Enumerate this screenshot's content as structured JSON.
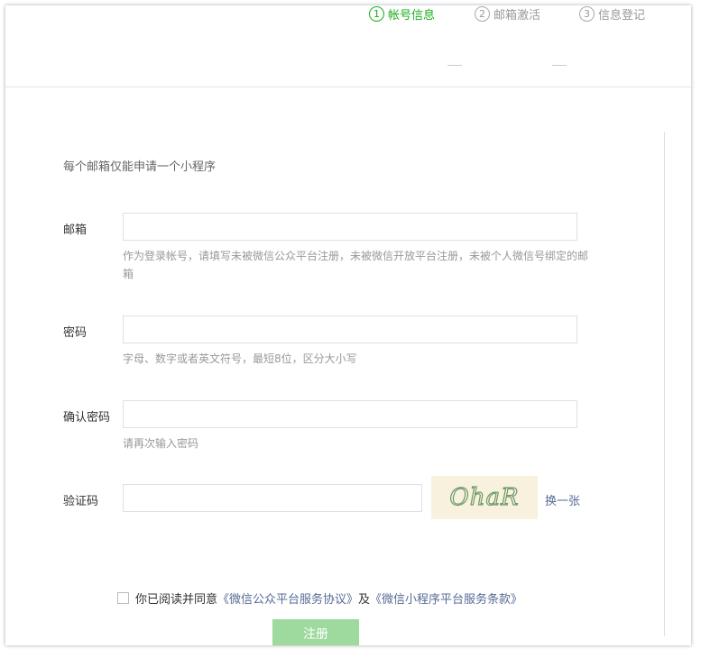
{
  "steps": [
    {
      "num": "1",
      "label": "帐号信息"
    },
    {
      "num": "2",
      "label": "邮箱激活"
    },
    {
      "num": "3",
      "label": "信息登记"
    }
  ],
  "form": {
    "intro": "每个邮箱仅能申请一个小程序",
    "email": {
      "label": "邮箱",
      "value": "",
      "placeholder": "",
      "hint": "作为登录帐号，请填写未被微信公众平台注册，未被微信开放平台注册，未被个人微信号绑定的邮箱"
    },
    "password": {
      "label": "密码",
      "value": "",
      "placeholder": "",
      "hint": "字母、数字或者英文符号，最短8位，区分大小写"
    },
    "confirm": {
      "label": "确认密码",
      "value": "",
      "placeholder": "",
      "hint": "请再次输入密码"
    },
    "captcha": {
      "label": "验证码",
      "value": "",
      "image_text": "OhaR",
      "refresh_label": "换一张"
    }
  },
  "agreement": {
    "prefix": "你已阅读并同意",
    "link1": "《微信公众平台服务协议》",
    "and": "及",
    "link2": "《微信小程序平台服务条款》",
    "checked": false
  },
  "submit_label": "注册",
  "colors": {
    "active": "#1aad19",
    "link": "#576b95",
    "submit_disabled": "#9ed99d",
    "captcha_bg": "#f7f1de"
  }
}
